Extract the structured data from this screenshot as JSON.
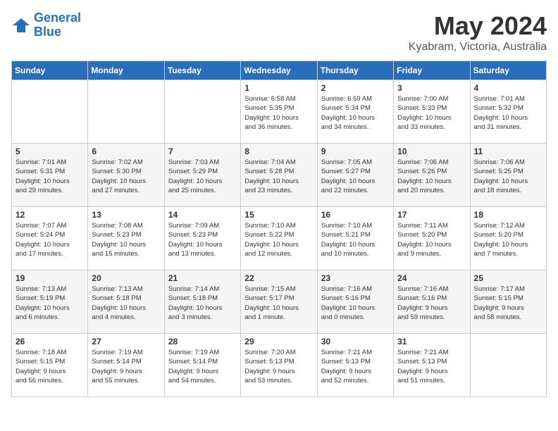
{
  "logo": {
    "line1": "General",
    "line2": "Blue"
  },
  "title": "May 2024",
  "subtitle": "Kyabram, Victoria, Australia",
  "days_of_week": [
    "Sunday",
    "Monday",
    "Tuesday",
    "Wednesday",
    "Thursday",
    "Friday",
    "Saturday"
  ],
  "weeks": [
    [
      {
        "day": "",
        "content": ""
      },
      {
        "day": "",
        "content": ""
      },
      {
        "day": "",
        "content": ""
      },
      {
        "day": "1",
        "content": "Sunrise: 6:58 AM\nSunset: 5:35 PM\nDaylight: 10 hours\nand 36 minutes."
      },
      {
        "day": "2",
        "content": "Sunrise: 6:59 AM\nSunset: 5:34 PM\nDaylight: 10 hours\nand 34 minutes."
      },
      {
        "day": "3",
        "content": "Sunrise: 7:00 AM\nSunset: 5:33 PM\nDaylight: 10 hours\nand 33 minutes."
      },
      {
        "day": "4",
        "content": "Sunrise: 7:01 AM\nSunset: 5:32 PM\nDaylight: 10 hours\nand 31 minutes."
      }
    ],
    [
      {
        "day": "5",
        "content": "Sunrise: 7:01 AM\nSunset: 5:31 PM\nDaylight: 10 hours\nand 29 minutes."
      },
      {
        "day": "6",
        "content": "Sunrise: 7:02 AM\nSunset: 5:30 PM\nDaylight: 10 hours\nand 27 minutes."
      },
      {
        "day": "7",
        "content": "Sunrise: 7:03 AM\nSunset: 5:29 PM\nDaylight: 10 hours\nand 25 minutes."
      },
      {
        "day": "8",
        "content": "Sunrise: 7:04 AM\nSunset: 5:28 PM\nDaylight: 10 hours\nand 23 minutes."
      },
      {
        "day": "9",
        "content": "Sunrise: 7:05 AM\nSunset: 5:27 PM\nDaylight: 10 hours\nand 22 minutes."
      },
      {
        "day": "10",
        "content": "Sunrise: 7:06 AM\nSunset: 5:26 PM\nDaylight: 10 hours\nand 20 minutes."
      },
      {
        "day": "11",
        "content": "Sunrise: 7:06 AM\nSunset: 5:25 PM\nDaylight: 10 hours\nand 18 minutes."
      }
    ],
    [
      {
        "day": "12",
        "content": "Sunrise: 7:07 AM\nSunset: 5:24 PM\nDaylight: 10 hours\nand 17 minutes."
      },
      {
        "day": "13",
        "content": "Sunrise: 7:08 AM\nSunset: 5:23 PM\nDaylight: 10 hours\nand 15 minutes."
      },
      {
        "day": "14",
        "content": "Sunrise: 7:09 AM\nSunset: 5:23 PM\nDaylight: 10 hours\nand 13 minutes."
      },
      {
        "day": "15",
        "content": "Sunrise: 7:10 AM\nSunset: 5:22 PM\nDaylight: 10 hours\nand 12 minutes."
      },
      {
        "day": "16",
        "content": "Sunrise: 7:10 AM\nSunset: 5:21 PM\nDaylight: 10 hours\nand 10 minutes."
      },
      {
        "day": "17",
        "content": "Sunrise: 7:11 AM\nSunset: 5:20 PM\nDaylight: 10 hours\nand 9 minutes."
      },
      {
        "day": "18",
        "content": "Sunrise: 7:12 AM\nSunset: 5:20 PM\nDaylight: 10 hours\nand 7 minutes."
      }
    ],
    [
      {
        "day": "19",
        "content": "Sunrise: 7:13 AM\nSunset: 5:19 PM\nDaylight: 10 hours\nand 6 minutes."
      },
      {
        "day": "20",
        "content": "Sunrise: 7:13 AM\nSunset: 5:18 PM\nDaylight: 10 hours\nand 4 minutes."
      },
      {
        "day": "21",
        "content": "Sunrise: 7:14 AM\nSunset: 5:18 PM\nDaylight: 10 hours\nand 3 minutes."
      },
      {
        "day": "22",
        "content": "Sunrise: 7:15 AM\nSunset: 5:17 PM\nDaylight: 10 hours\nand 1 minute."
      },
      {
        "day": "23",
        "content": "Sunrise: 7:16 AM\nSunset: 5:16 PM\nDaylight: 10 hours\nand 0 minutes."
      },
      {
        "day": "24",
        "content": "Sunrise: 7:16 AM\nSunset: 5:16 PM\nDaylight: 9 hours\nand 59 minutes."
      },
      {
        "day": "25",
        "content": "Sunrise: 7:17 AM\nSunset: 5:15 PM\nDaylight: 9 hours\nand 58 minutes."
      }
    ],
    [
      {
        "day": "26",
        "content": "Sunrise: 7:18 AM\nSunset: 5:15 PM\nDaylight: 9 hours\nand 56 minutes."
      },
      {
        "day": "27",
        "content": "Sunrise: 7:19 AM\nSunset: 5:14 PM\nDaylight: 9 hours\nand 55 minutes."
      },
      {
        "day": "28",
        "content": "Sunrise: 7:19 AM\nSunset: 5:14 PM\nDaylight: 9 hours\nand 54 minutes."
      },
      {
        "day": "29",
        "content": "Sunrise: 7:20 AM\nSunset: 5:13 PM\nDaylight: 9 hours\nand 53 minutes."
      },
      {
        "day": "30",
        "content": "Sunrise: 7:21 AM\nSunset: 5:13 PM\nDaylight: 9 hours\nand 52 minutes."
      },
      {
        "day": "31",
        "content": "Sunrise: 7:21 AM\nSunset: 5:13 PM\nDaylight: 9 hours\nand 51 minutes."
      },
      {
        "day": "",
        "content": ""
      }
    ]
  ]
}
